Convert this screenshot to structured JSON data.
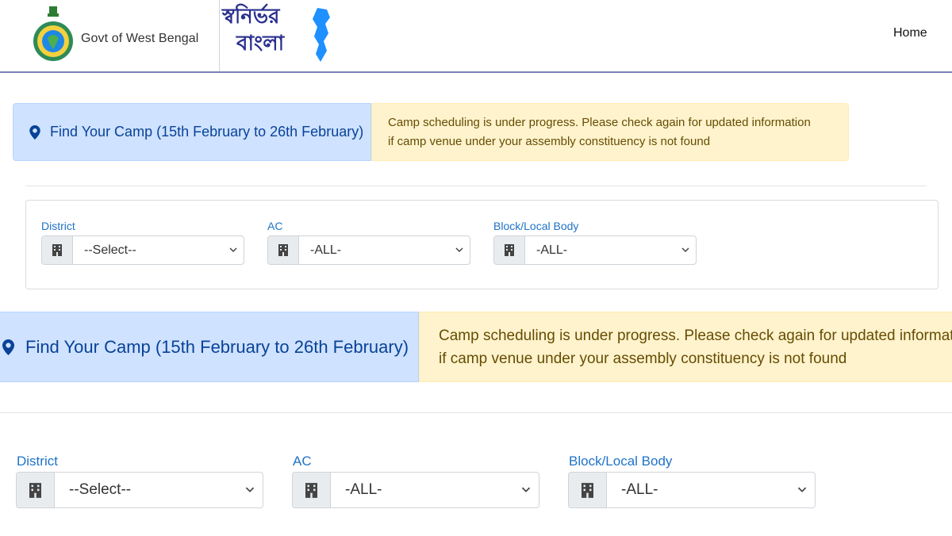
{
  "header": {
    "gov_name": "Govt of West Bengal",
    "logo_text_line1": "স্বনির্ভর",
    "logo_text_line2": "বাংলা",
    "nav": {
      "home": "Home"
    }
  },
  "banner": {
    "title": "Find Your Camp (15th February to 26th February)",
    "notice_line1": "Camp scheduling is under progress. Please check again for updated information",
    "notice_line2": "if camp venue under your assembly constituency is not found"
  },
  "filters": {
    "district": {
      "label": "District",
      "value": "--Select--"
    },
    "ac": {
      "label": "AC",
      "value": "-ALL-"
    },
    "block": {
      "label": "Block/Local Body",
      "value": "-ALL-"
    }
  },
  "icons": {
    "pin": "map-marker-icon",
    "building": "building-icon",
    "chevron": "chevron-down-icon"
  },
  "colors": {
    "info_bg": "#cfe2ff",
    "info_text": "#084298",
    "warning_bg": "#fff3cd",
    "warning_text": "#664d03",
    "label_blue": "#1f73c7",
    "logo_blue": "#2a2f8f"
  }
}
